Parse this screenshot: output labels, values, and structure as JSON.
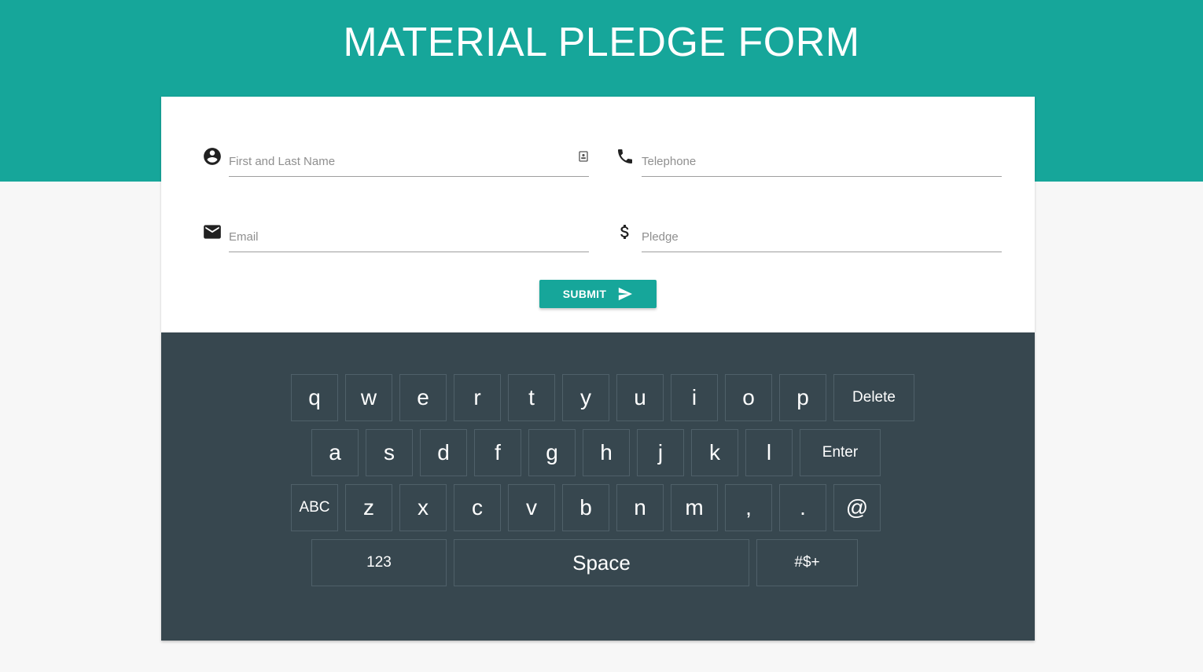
{
  "header": {
    "title": "MATERIAL PLEDGE FORM",
    "background_color": "#16a69a"
  },
  "form": {
    "fields": {
      "name": {
        "placeholder": "First and Last Name",
        "value": "",
        "icon": "account-circle-icon",
        "trailing_icon": "contact-card-icon"
      },
      "telephone": {
        "placeholder": "Telephone",
        "value": "",
        "icon": "phone-icon"
      },
      "email": {
        "placeholder": "Email",
        "value": "",
        "icon": "mail-icon"
      },
      "pledge": {
        "placeholder": "Pledge",
        "value": "",
        "icon": "dollar-icon"
      }
    },
    "submit_label": "SUBMIT",
    "submit_icon": "send-icon",
    "accent_color": "#16a69a"
  },
  "keyboard": {
    "background_color": "#37474f",
    "row1": [
      "q",
      "w",
      "e",
      "r",
      "t",
      "y",
      "u",
      "i",
      "o",
      "p"
    ],
    "row1_end": "Delete",
    "row2": [
      "a",
      "s",
      "d",
      "f",
      "g",
      "h",
      "j",
      "k",
      "l"
    ],
    "row2_end": "Enter",
    "row3_start": "ABC",
    "row3": [
      "z",
      "x",
      "c",
      "v",
      "b",
      "n",
      "m",
      ",",
      ".",
      "@"
    ],
    "row4": {
      "numbers": "123",
      "space": "Space",
      "symbols": "#$+"
    }
  }
}
